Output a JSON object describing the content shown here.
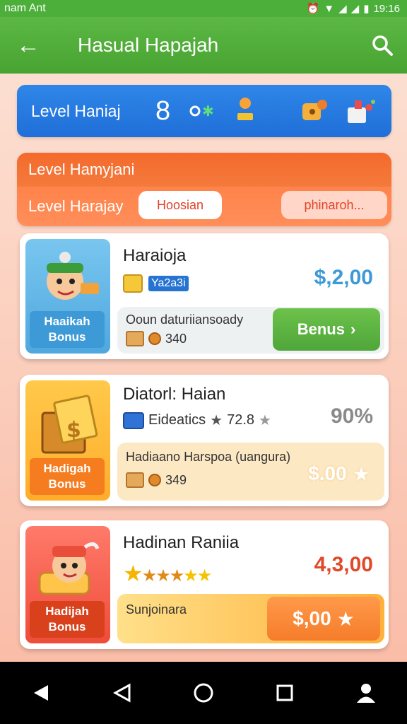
{
  "status_bar": {
    "carrier": "nam Ant",
    "time": "19:16"
  },
  "app_bar": {
    "title": "Hasual Hapajah"
  },
  "level_bar": {
    "label": "Level Haniaj",
    "level": "8"
  },
  "level_panel": {
    "title": "Level Hamyjani",
    "row_label": "Level Harajay",
    "pill_left": "Hoosian",
    "pill_right": "phinaroh..."
  },
  "cards": [
    {
      "name": "Haraioja",
      "tag": "Ya2a3i",
      "price": "$,2,00",
      "sub_text": "Ooun daturiiansoady",
      "meta_value": "340",
      "button_label": "Benus",
      "badge": [
        "Haaikah",
        "Bonus"
      ]
    },
    {
      "name": "Diatorl: Haian",
      "detail": "Eideatics",
      "rating": "72.8",
      "price": "90%",
      "sub_text": "Hadiaano Harspoa (uangura)",
      "meta_value": "349",
      "button_label": "$.00",
      "badge": [
        "Hadigah",
        "Bonus"
      ]
    },
    {
      "name": "Hadinan Raniia",
      "price": "4,3,00",
      "sub_text": "Sunjoinara",
      "button_label": "$,00",
      "badge": [
        "Hadijah",
        "Bonus"
      ]
    }
  ],
  "colors": {
    "app_bar": "#4caf3a",
    "level_bar": "#2378df",
    "orange": "#f46a2c",
    "price_blue": "#3d9ad6",
    "price_red": "#e04a2a",
    "benus_green": "#5cb843"
  }
}
